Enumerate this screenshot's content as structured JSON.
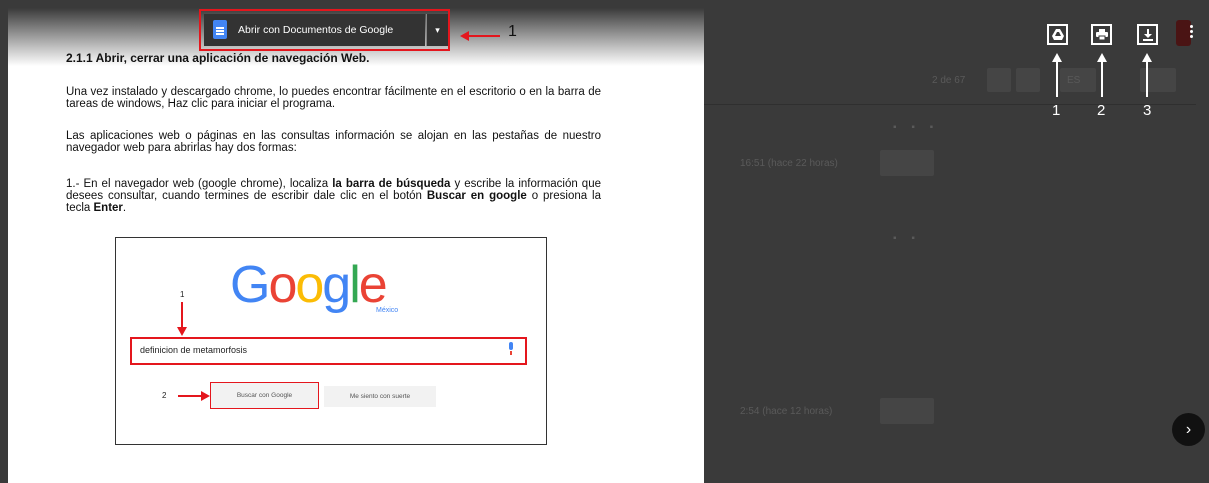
{
  "viewer": {
    "open_with_label": "Abrir con Documentos de Google",
    "open_with_caret": "▾",
    "callout_numbers": [
      "1",
      "1",
      "2",
      "3"
    ],
    "next_icon": "chevron-right-icon"
  },
  "document": {
    "heading": "2.1.1 Abrir, cerrar una aplicación de navegación Web.",
    "para1": "Una vez instalado y descargado chrome, lo puedes encontrar fácilmente en el escritorio o en la barra de tareas de windows, Haz clic para iniciar el programa.",
    "para2": "Las aplicaciones web o páginas en las consultas información se alojan en las pestañas de nuestro navegador web para abrirlas hay dos formas:",
    "para3_a": "1.- En el navegador web (google chrome), localiza ",
    "para3_b": "la barra de búsqueda",
    "para3_c": " y escribe la información que desees consultar, cuando termines de escribir dale clic en el botón ",
    "para3_d": "Buscar en google",
    "para3_e": " o presiona la tecla ",
    "para3_f": "Enter",
    "para3_g": "."
  },
  "figure": {
    "logo_letters": [
      "G",
      "o",
      "o",
      "g",
      "l",
      "e"
    ],
    "logo_colors": [
      "#4285f4",
      "#ea4335",
      "#fbbc05",
      "#4285f4",
      "#34a853",
      "#ea4335"
    ],
    "region": "México",
    "search_value": "definicion de metamorfosis",
    "btn_search": "Buscar con Google",
    "btn_lucky": "Me siento con suerte",
    "label_1": "1",
    "label_2": "2"
  },
  "gmail_bg": {
    "pager": "2 de 67",
    "lang": "ES",
    "time1": "16:51 (hace 22 horas)",
    "time2": "2:54 (hace 12 horas)"
  },
  "toolbar": {
    "add_to_drive_label": "1",
    "print_label": "2",
    "download_label": "3"
  }
}
